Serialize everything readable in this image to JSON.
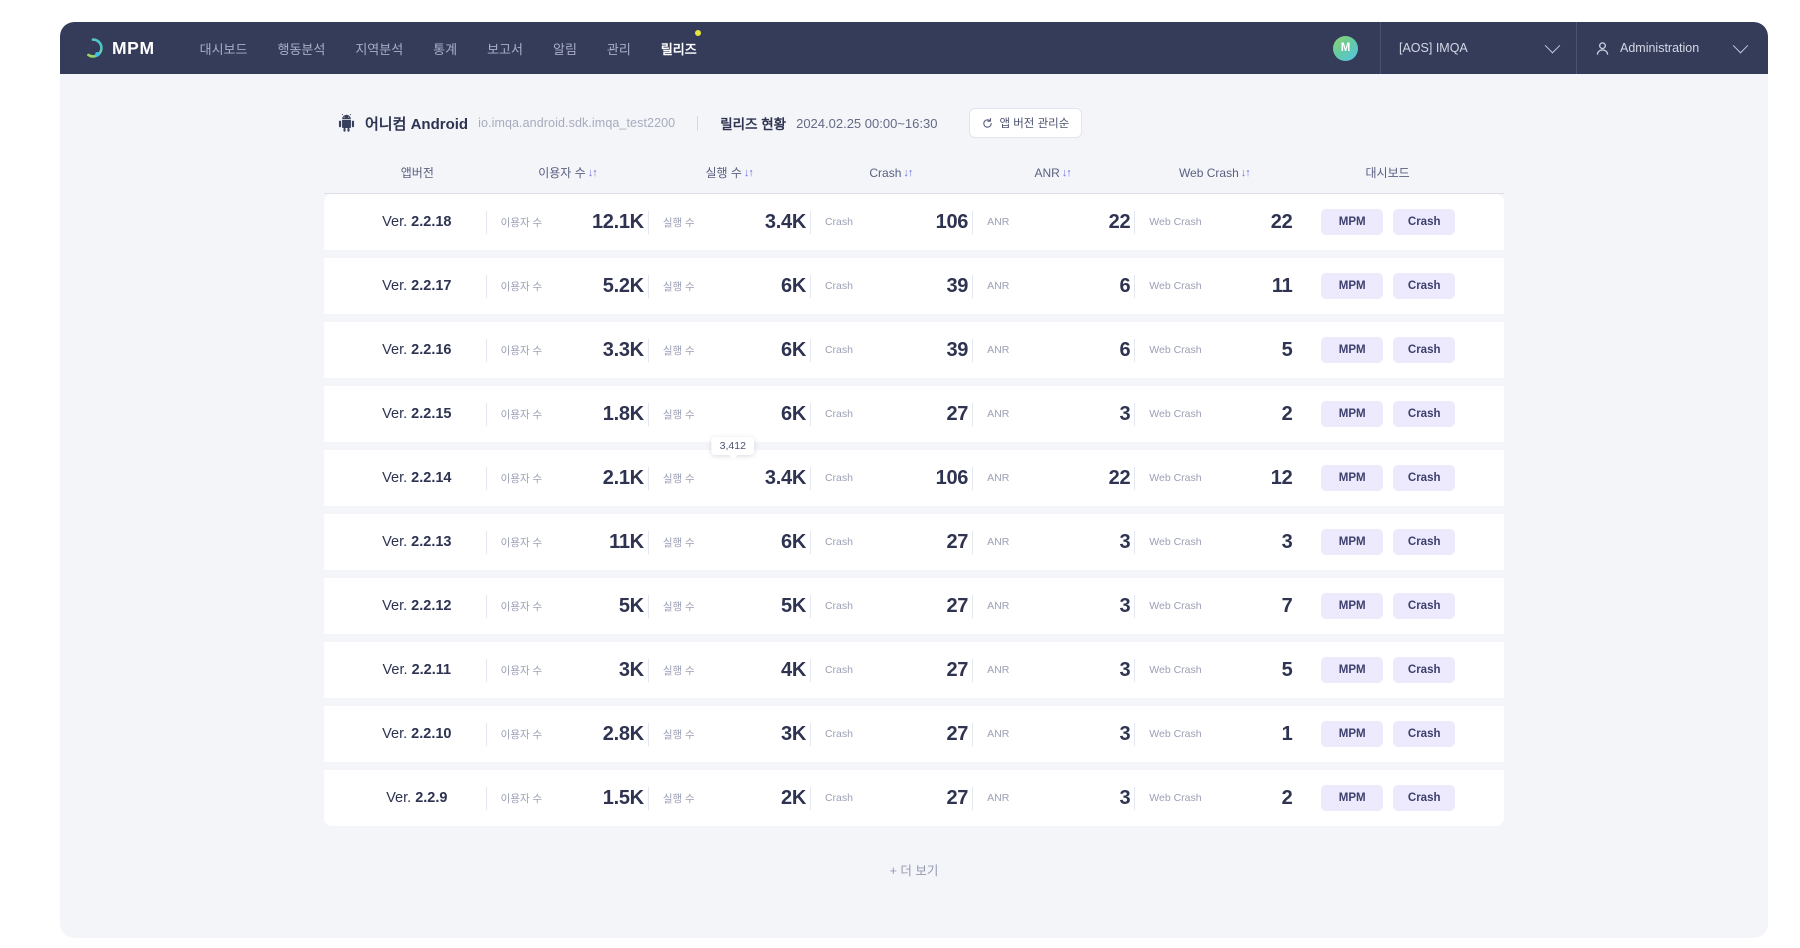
{
  "header": {
    "brand": "MPM",
    "logo_icon": "q-ring-logo-icon",
    "nav": [
      {
        "label": "대시보드",
        "active": false,
        "dot": false
      },
      {
        "label": "행동분석",
        "active": false,
        "dot": false
      },
      {
        "label": "지역분석",
        "active": false,
        "dot": false
      },
      {
        "label": "통계",
        "active": false,
        "dot": false
      },
      {
        "label": "보고서",
        "active": false,
        "dot": false
      },
      {
        "label": "알림",
        "active": false,
        "dot": false
      },
      {
        "label": "관리",
        "active": false,
        "dot": false
      },
      {
        "label": "릴리즈",
        "active": true,
        "dot": true
      }
    ],
    "avatar_initial": "M",
    "project_selector": "[AOS] IMQA",
    "account_selector": "Administration"
  },
  "app_info": {
    "platform_icon": "android-icon",
    "name": "어니컴 Android",
    "package": "io.imqa.android.sdk.imqa_test2200",
    "release_label": "릴리즈 현황",
    "release_range": "2024.02.25 00:00~16:30",
    "sort_button": "앱 버전 관리순",
    "sort_button_icon": "refresh-icon"
  },
  "table": {
    "columns": [
      {
        "label": "앱버전",
        "sortable": false
      },
      {
        "label": "이용자 수",
        "sortable": true
      },
      {
        "label": "실행 수",
        "sortable": true
      },
      {
        "label": "Crash",
        "sortable": true
      },
      {
        "label": "ANR",
        "sortable": true
      },
      {
        "label": "Web Crash",
        "sortable": true
      },
      {
        "label": "대시보드",
        "sortable": false
      }
    ],
    "sort_glyph": "↓↑",
    "inline_labels": {
      "users": "이용자 수",
      "sessions": "실행 수",
      "crash": "Crash",
      "anr": "ANR",
      "webcrash": "Web Crash"
    },
    "actions": {
      "mpm": "MPM",
      "crash": "Crash"
    },
    "version_prefix": "Ver. ",
    "rows": [
      {
        "version": "2.2.18",
        "users": "12.1K",
        "sessions": "3.4K",
        "crash": "106",
        "anr": "22",
        "webcrash": "22",
        "tooltip": null
      },
      {
        "version": "2.2.17",
        "users": "5.2K",
        "sessions": "6K",
        "crash": "39",
        "anr": "6",
        "webcrash": "11",
        "tooltip": null
      },
      {
        "version": "2.2.16",
        "users": "3.3K",
        "sessions": "6K",
        "crash": "39",
        "anr": "6",
        "webcrash": "5",
        "tooltip": null
      },
      {
        "version": "2.2.15",
        "users": "1.8K",
        "sessions": "6K",
        "crash": "27",
        "anr": "3",
        "webcrash": "2",
        "tooltip": null
      },
      {
        "version": "2.2.14",
        "users": "2.1K",
        "sessions": "3.4K",
        "crash": "106",
        "anr": "22",
        "webcrash": "12",
        "tooltip": "3,412"
      },
      {
        "version": "2.2.13",
        "users": "11K",
        "sessions": "6K",
        "crash": "27",
        "anr": "3",
        "webcrash": "3",
        "tooltip": null
      },
      {
        "version": "2.2.12",
        "users": "5K",
        "sessions": "5K",
        "crash": "27",
        "anr": "3",
        "webcrash": "7",
        "tooltip": null
      },
      {
        "version": "2.2.11",
        "users": "3K",
        "sessions": "4K",
        "crash": "27",
        "anr": "3",
        "webcrash": "5",
        "tooltip": null
      },
      {
        "version": "2.2.10",
        "users": "2.8K",
        "sessions": "3K",
        "crash": "27",
        "anr": "3",
        "webcrash": "1",
        "tooltip": null
      },
      {
        "version": "2.2.9",
        "users": "1.5K",
        "sessions": "2K",
        "crash": "27",
        "anr": "3",
        "webcrash": "2",
        "tooltip": null
      }
    ]
  },
  "footer": {
    "more_label": "+ 더 보기"
  },
  "colors": {
    "header_bg": "#353c5a",
    "content_bg": "#f4f5f9",
    "accent": "#6d72e0",
    "pill_bg": "#eceafc",
    "text_dark": "#2d3350",
    "notification_dot": "#e3e63b"
  }
}
